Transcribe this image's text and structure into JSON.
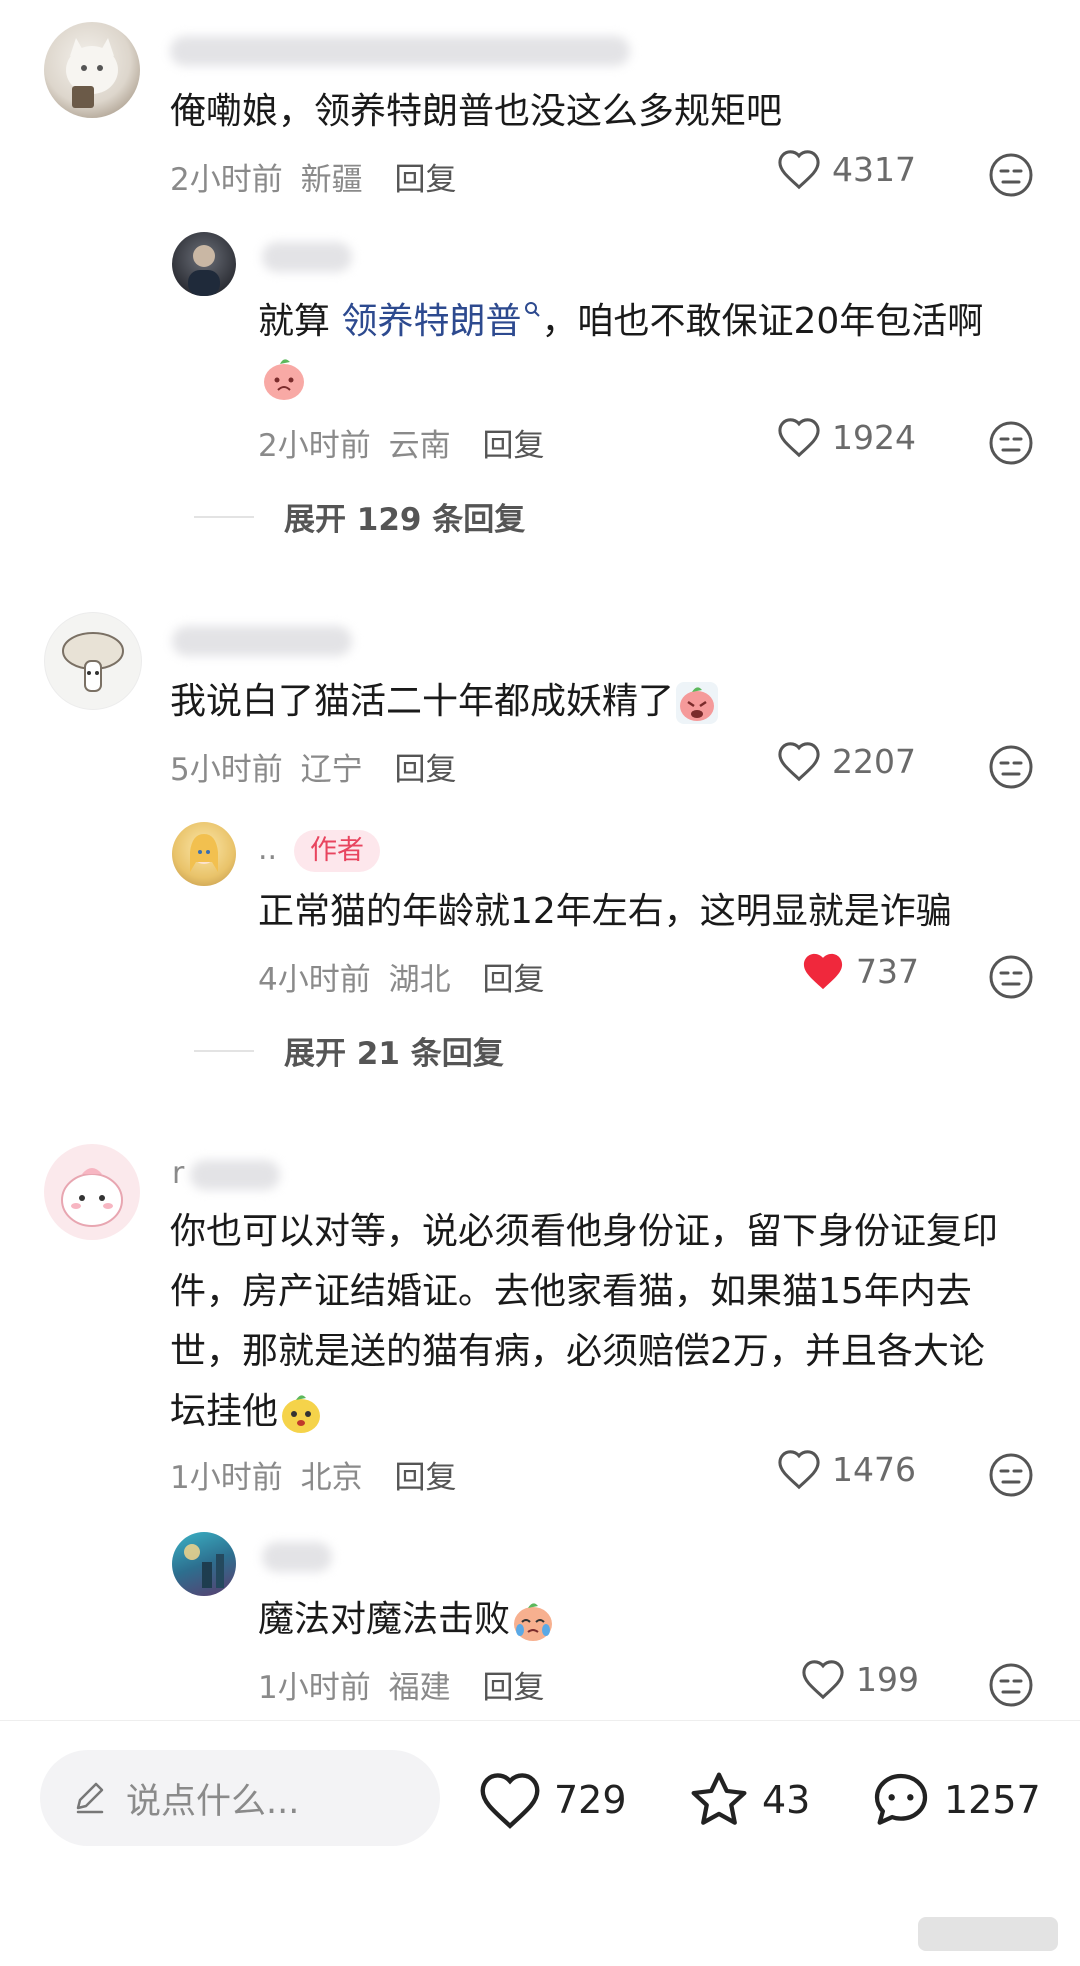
{
  "comments": [
    {
      "text": "俺嘞娘，领养特朗普也没这么多规矩吧",
      "time": "2小时前",
      "location": "新疆",
      "reply_label": "回复",
      "likes": "4317",
      "replies": [
        {
          "text_before": "就算 ",
          "mention": "领养特朗普",
          "text_after": "，咱也不敢保证20年包活啊",
          "time": "2小时前",
          "location": "云南",
          "reply_label": "回复",
          "likes": "1924"
        }
      ],
      "expand_label": "展开 129 条回复"
    },
    {
      "text": "我说白了猫活二十年都成妖精了",
      "time": "5小时前",
      "location": "辽宁",
      "reply_label": "回复",
      "likes": "2207",
      "replies": [
        {
          "name": "..",
          "badge": "作者",
          "text": "正常猫的年龄就12年左右，这明显就是诈骗",
          "time": "4小时前",
          "location": "湖北",
          "reply_label": "回复",
          "likes": "737",
          "liked": true
        }
      ],
      "expand_label": "展开 21 条回复"
    },
    {
      "name_initial": "r",
      "text_lines": [
        "你也可以对等，说必须看他身份证，留下身份证复印",
        "件，房产证结婚证。去他家看猫，如果猫15年内去",
        "世，那就是送的猫有病，必须赔偿2万，并且各大论",
        "坛挂他"
      ],
      "time": "1小时前",
      "location": "北京",
      "reply_label": "回复",
      "likes": "1476",
      "replies": [
        {
          "text": "魔法对魔法击败",
          "time": "1小时前",
          "location": "福建",
          "reply_label": "回复",
          "likes": "199"
        }
      ]
    }
  ],
  "bottom_bar": {
    "input_placeholder": "说点什么...",
    "likes": "729",
    "favorites": "43",
    "comments": "1257"
  },
  "colors": {
    "liked_red": "#f0283c",
    "mention_blue": "#2d4a8f",
    "badge_bg": "#fde7ec",
    "badge_text": "#e8455f"
  }
}
